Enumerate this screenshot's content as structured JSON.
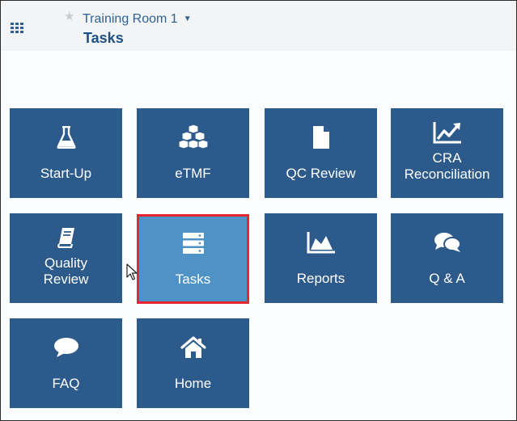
{
  "header": {
    "room_title": "Training Room 1",
    "page_title": "Tasks"
  },
  "tiles": [
    {
      "label": "Start-Up",
      "icon": "flask-icon"
    },
    {
      "label": "eTMF",
      "icon": "cubes-icon"
    },
    {
      "label": "QC Review",
      "icon": "document-icon"
    },
    {
      "label": "CRA\nReconciliation",
      "icon": "line-chart-icon"
    },
    {
      "label": "Quality\nReview",
      "icon": "book-icon"
    },
    {
      "label": "Tasks",
      "icon": "server-list-icon",
      "selected": true
    },
    {
      "label": "Reports",
      "icon": "area-chart-icon"
    },
    {
      "label": "Q & A",
      "icon": "chat-bubbles-icon"
    },
    {
      "label": "FAQ",
      "icon": "speech-bubble-icon"
    },
    {
      "label": "Home",
      "icon": "home-icon"
    }
  ],
  "colors": {
    "tile": "#2c5a8a",
    "tile_selected": "#4e92c6",
    "selected_border": "#e4262f",
    "title_text": "#2d6294"
  }
}
